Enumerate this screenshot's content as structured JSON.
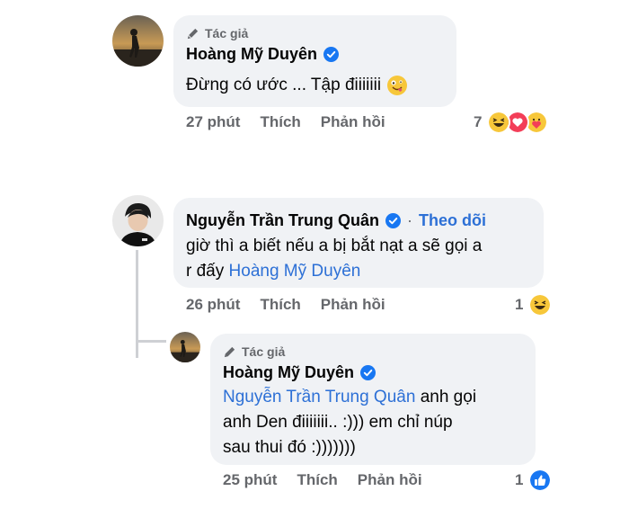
{
  "comments": [
    {
      "author_tag": "Tác giả",
      "name": "Hoàng Mỹ Duyên",
      "text": "Đừng có ước ... Tập điiiiiii",
      "emoji": "zany-face",
      "time": "27 phút",
      "like_label": "Thích",
      "reply_label": "Phản hồi",
      "reaction_count": "7",
      "reactions": [
        "haha-icon",
        "love-icon",
        "care-icon"
      ]
    },
    {
      "name": "Nguyễn Trần Trung Quân",
      "follow_label": "Theo dõi",
      "text_line1": "giờ thì a biết nếu a bị bắt nạt a sẽ gọi a",
      "text_line2_prefix": "r đấy ",
      "mention": "Hoàng Mỹ Duyên",
      "time": "26 phút",
      "like_label": "Thích",
      "reply_label": "Phản hồi",
      "reaction_count": "1",
      "reactions": [
        "haha-icon"
      ]
    },
    {
      "author_tag": "Tác giả",
      "name": "Hoàng Mỹ Duyên",
      "mention": "Nguyễn Trần Trung Quân",
      "text_line1_suffix": " anh gọi",
      "text_line2": "anh Den điiiiiii.. :))) em chỉ núp",
      "text_line3": "sau thui đó :)))))))",
      "time": "25 phút",
      "like_label": "Thích",
      "reply_label": "Phản hồi",
      "reaction_count": "1",
      "reactions": [
        "like-icon"
      ]
    }
  ],
  "colors": {
    "bubble": "#f0f2f5",
    "link": "#2d70d6",
    "muted": "#65676b"
  }
}
